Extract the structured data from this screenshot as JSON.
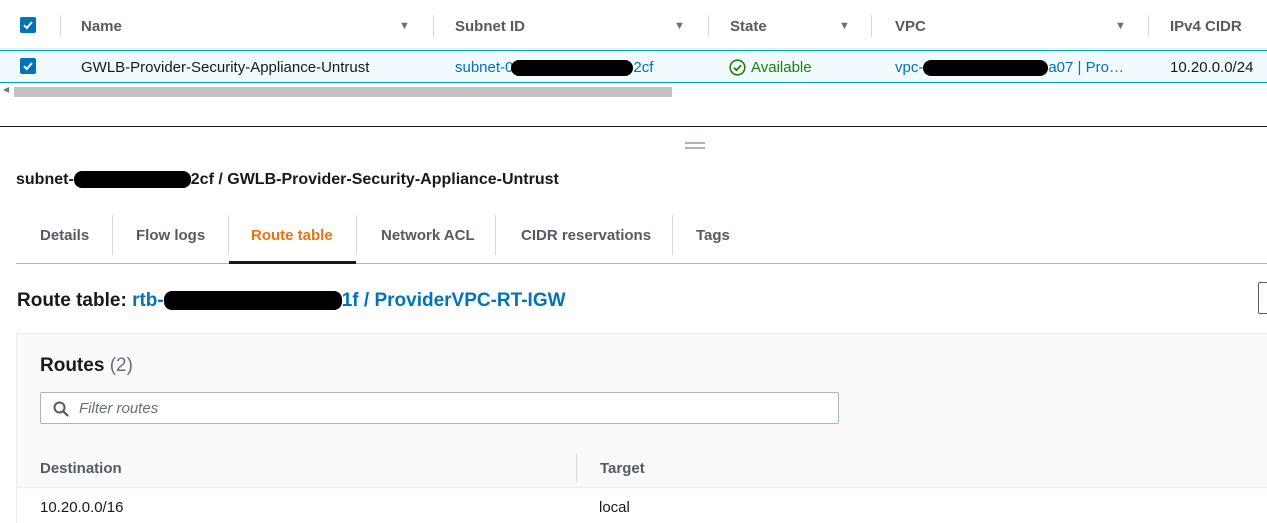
{
  "subnet_table": {
    "columns": [
      {
        "label": "Name"
      },
      {
        "label": "Subnet ID"
      },
      {
        "label": "State"
      },
      {
        "label": "VPC"
      },
      {
        "label": "IPv4 CIDR"
      }
    ],
    "selected_row": {
      "name": "GWLB-Provider-Security-Appliance-Untrust",
      "subnet_id_prefix": "subnet-0",
      "subnet_id_suffix": "2cf",
      "state": "Available",
      "vpc_prefix": "vpc-",
      "vpc_suffix": "a07 | Pro…",
      "ipv4_cidr": "10.20.0.0/24"
    }
  },
  "detail": {
    "title_prefix": "subnet-",
    "title_suffix": "2cf / GWLB-Provider-Security-Appliance-Untrust",
    "tabs": [
      {
        "label": "Details"
      },
      {
        "label": "Flow logs"
      },
      {
        "label": "Route table"
      },
      {
        "label": "Network ACL"
      },
      {
        "label": "CIDR reservations"
      },
      {
        "label": "Tags"
      }
    ],
    "active_tab": "Route table",
    "route_table": {
      "label": "Route table:",
      "value_prefix": "rtb-",
      "value_suffix": "1f / ProviderVPC-RT-IGW"
    },
    "routes": {
      "title": "Routes",
      "count": "(2)",
      "filter_placeholder": "Filter routes",
      "columns": [
        "Destination",
        "Target"
      ],
      "rows": [
        {
          "destination": "10.20.0.0/16",
          "target": "local"
        }
      ]
    }
  },
  "colors": {
    "link": "#0073bb",
    "active_tab": "#ec7211",
    "available": "#1d8102",
    "checkbox": "#0073bb"
  }
}
